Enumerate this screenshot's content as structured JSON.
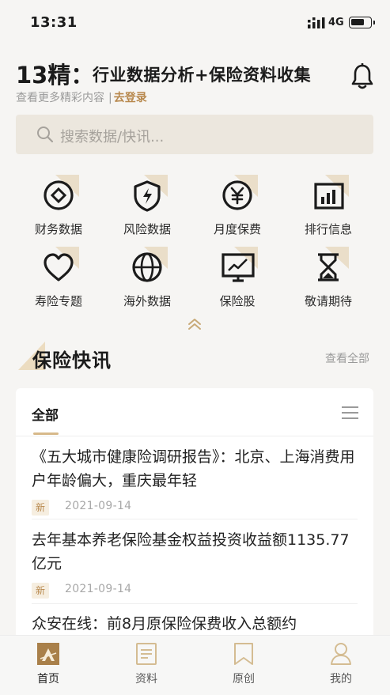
{
  "status_bar": {
    "time": "13:31",
    "network": "4G"
  },
  "header": {
    "brand": "13精：",
    "headline": "行业数据分析+保险资料收集",
    "subtitle": "查看更多精彩内容",
    "separator": "|",
    "login_link": "去登录"
  },
  "search": {
    "placeholder": "搜索数据/快讯..."
  },
  "grid": [
    {
      "label": "财务数据",
      "icon": "diamond-coin-icon"
    },
    {
      "label": "风险数据",
      "icon": "shield-bolt-icon"
    },
    {
      "label": "月度保费",
      "icon": "yen-coin-icon"
    },
    {
      "label": "排行信息",
      "icon": "bar-chart-icon"
    },
    {
      "label": "寿险专题",
      "icon": "heart-icon"
    },
    {
      "label": "海外数据",
      "icon": "globe-icon"
    },
    {
      "label": "保险股",
      "icon": "stock-monitor-icon"
    },
    {
      "label": "敬请期待",
      "icon": "hourglass-icon"
    }
  ],
  "section": {
    "title": "保险快讯",
    "more": "查看全部"
  },
  "news_card": {
    "tab": "全部",
    "items": [
      {
        "title": "《五大城市健康险调研报告》：北京、上海消费用户年龄偏大，重庆最年轻",
        "badge": "新",
        "date": "2021-09-14"
      },
      {
        "title": "去年基本养老保险基金权益投资收益额1135.77亿元",
        "badge": "新",
        "date": "2021-09-14"
      },
      {
        "title": "众安在线：前8月原保险保费收入总额约",
        "second_line": "",
        "badge": "",
        "date": ""
      }
    ]
  },
  "bottom_nav": [
    {
      "label": "首页",
      "icon": "home-logo-icon",
      "active": true
    },
    {
      "label": "资料",
      "icon": "document-icon",
      "active": false
    },
    {
      "label": "原创",
      "icon": "bookmark-icon",
      "active": false
    },
    {
      "label": "我的",
      "icon": "user-icon",
      "active": false
    }
  ],
  "colors": {
    "accent": "#b8894e",
    "accent_light": "#e9dcc4",
    "search_bg": "#ece7de",
    "background": "#f6f5f3"
  }
}
